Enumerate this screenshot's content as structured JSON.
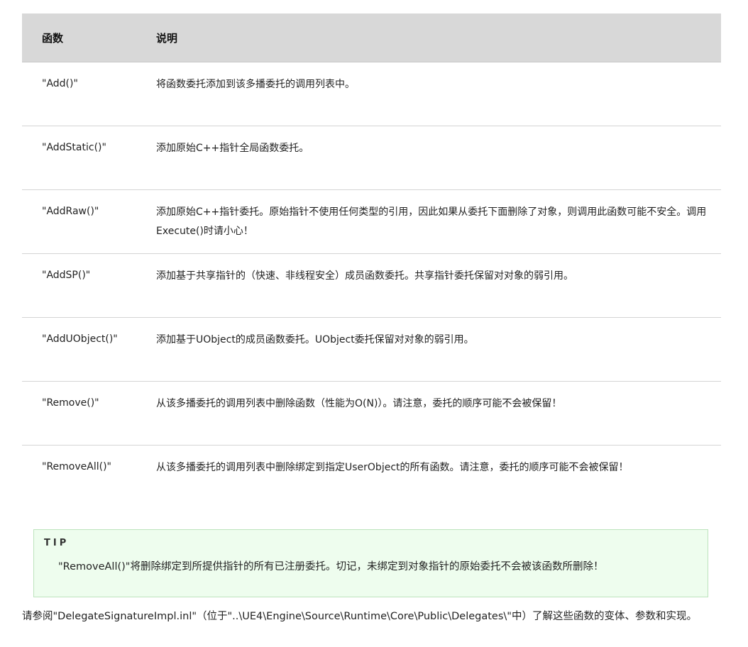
{
  "table": {
    "headers": {
      "function": "函数",
      "description": "说明"
    },
    "rows": [
      {
        "fn": "\"Add()\"",
        "desc": "将函数委托添加到该多播委托的调用列表中。"
      },
      {
        "fn": "\"AddStatic()\"",
        "desc": "添加原始C++指针全局函数委托。"
      },
      {
        "fn": "\"AddRaw()\"",
        "desc": "添加原始C++指针委托。原始指针不使用任何类型的引用，因此如果从委托下面删除了对象，则调用此函数可能不安全。调用Execute()时请小心！"
      },
      {
        "fn": "\"AddSP()\"",
        "desc": "添加基于共享指针的（快速、非线程安全）成员函数委托。共享指针委托保留对对象的弱引用。"
      },
      {
        "fn": "\"AddUObject()\"",
        "desc": "添加基于UObject的成员函数委托。UObject委托保留对对象的弱引用。"
      },
      {
        "fn": "\"Remove()\"",
        "desc": "从该多播委托的调用列表中删除函数（性能为O(N)）。请注意，委托的顺序可能不会被保留！"
      },
      {
        "fn": "\"RemoveAll()\"",
        "desc": "从该多播委托的调用列表中删除绑定到指定UserObject的所有函数。请注意，委托的顺序可能不会被保留！"
      }
    ]
  },
  "tip": {
    "title": "TIP",
    "body": "\"RemoveAll()\"将删除绑定到所提供指针的所有已注册委托。切记，未绑定到对象指针的原始委托不会被该函数所删除！"
  },
  "footer": {
    "text": "请参阅\"DelegateSignatureImpl.inl\"（位于\"..\\UE4\\Engine\\Source\\Runtime\\Core\\Public\\Delegates\\\"中）了解这些函数的变体、参数和实现。"
  }
}
